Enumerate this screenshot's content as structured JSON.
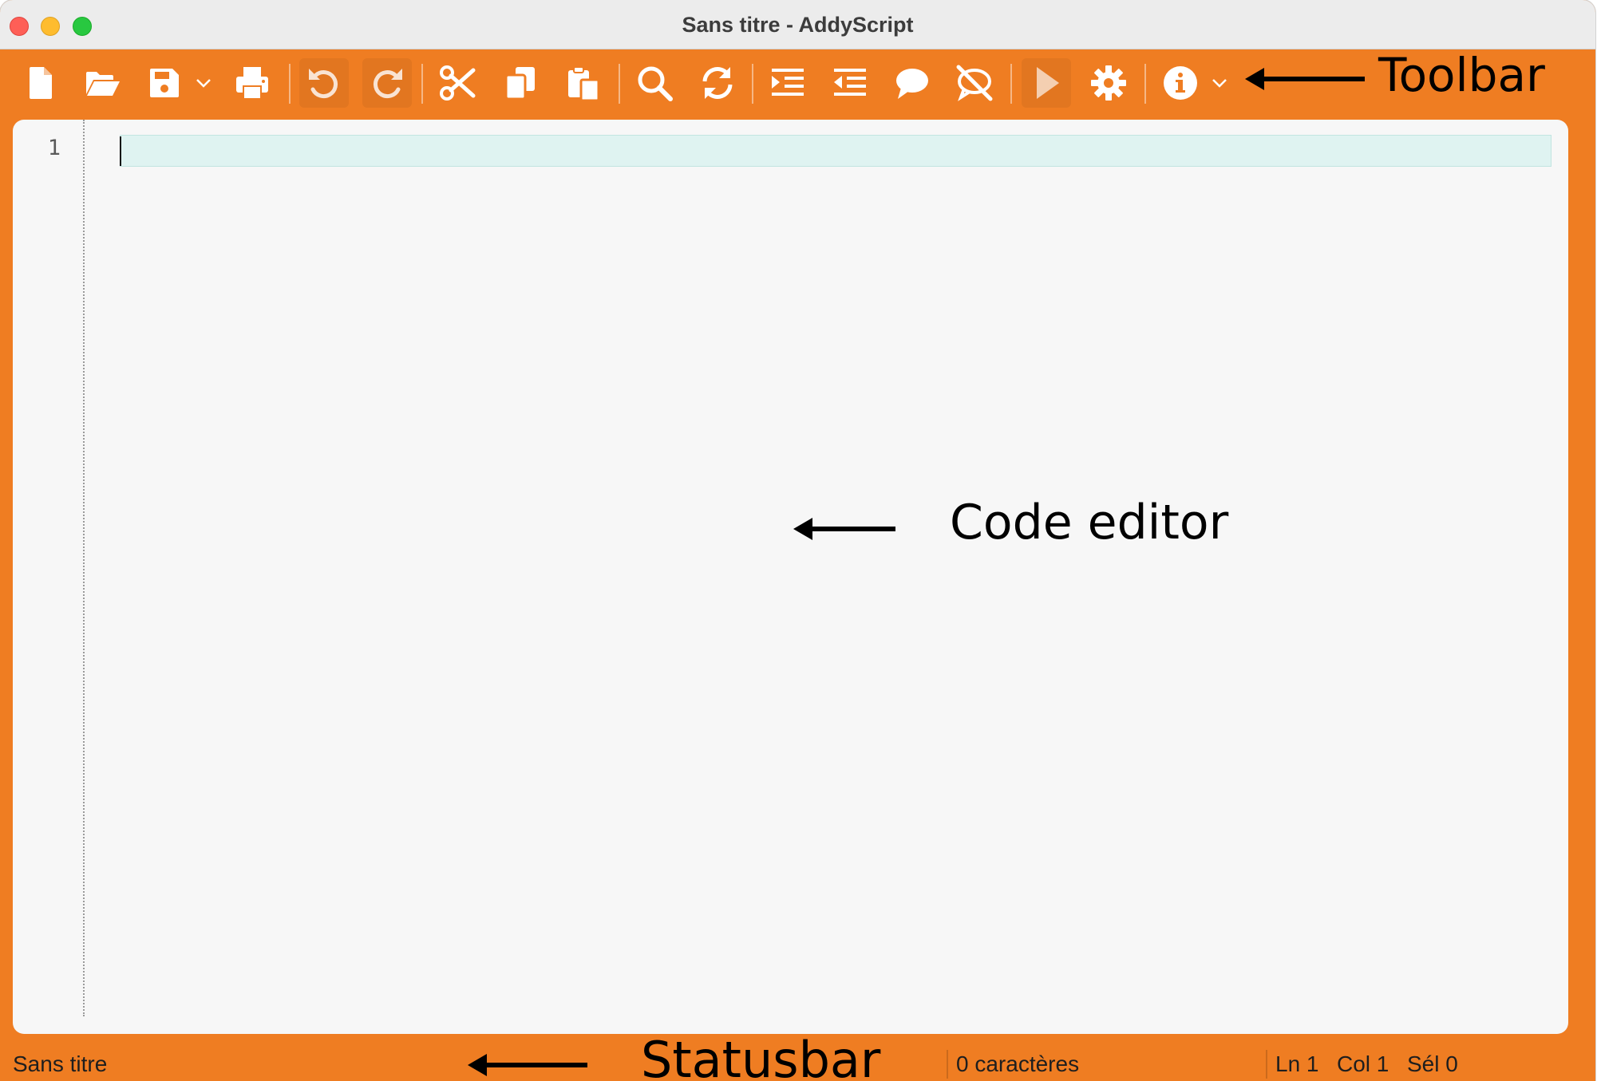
{
  "window": {
    "title": "Sans titre - AddyScript",
    "colors": {
      "chrome": "#EF7D22",
      "icon": "#FFFFFF",
      "editor_bg": "#F7F7F7",
      "current_line": "#DFF3F1"
    }
  },
  "toolbar": {
    "buttons": [
      {
        "id": "new",
        "icon": "new-file-icon"
      },
      {
        "id": "open",
        "icon": "open-folder-icon"
      },
      {
        "id": "save",
        "icon": "save-icon",
        "has_dropdown": true
      },
      {
        "id": "print",
        "icon": "print-icon"
      },
      {
        "id": "undo",
        "icon": "undo-icon"
      },
      {
        "id": "redo",
        "icon": "redo-icon"
      },
      {
        "id": "cut",
        "icon": "scissors-icon"
      },
      {
        "id": "copy",
        "icon": "copy-icon"
      },
      {
        "id": "paste",
        "icon": "paste-icon"
      },
      {
        "id": "find",
        "icon": "search-icon"
      },
      {
        "id": "replace",
        "icon": "refresh-icon"
      },
      {
        "id": "indent",
        "icon": "indent-icon"
      },
      {
        "id": "outdent",
        "icon": "outdent-icon"
      },
      {
        "id": "comment",
        "icon": "comment-icon"
      },
      {
        "id": "uncomment",
        "icon": "uncomment-icon"
      },
      {
        "id": "run",
        "icon": "play-icon"
      },
      {
        "id": "settings",
        "icon": "gear-icon"
      },
      {
        "id": "info",
        "icon": "info-icon",
        "has_dropdown": true
      }
    ]
  },
  "editor": {
    "line_numbers": [
      "1"
    ],
    "content": ""
  },
  "statusbar": {
    "document_name": "Sans titre",
    "char_count": "0 caractères",
    "line": "Ln 1",
    "column": "Col 1",
    "selection": "Sél 0"
  },
  "annotations": {
    "toolbar": "Toolbar",
    "code_editor": "Code editor",
    "statusbar": "Statusbar"
  }
}
